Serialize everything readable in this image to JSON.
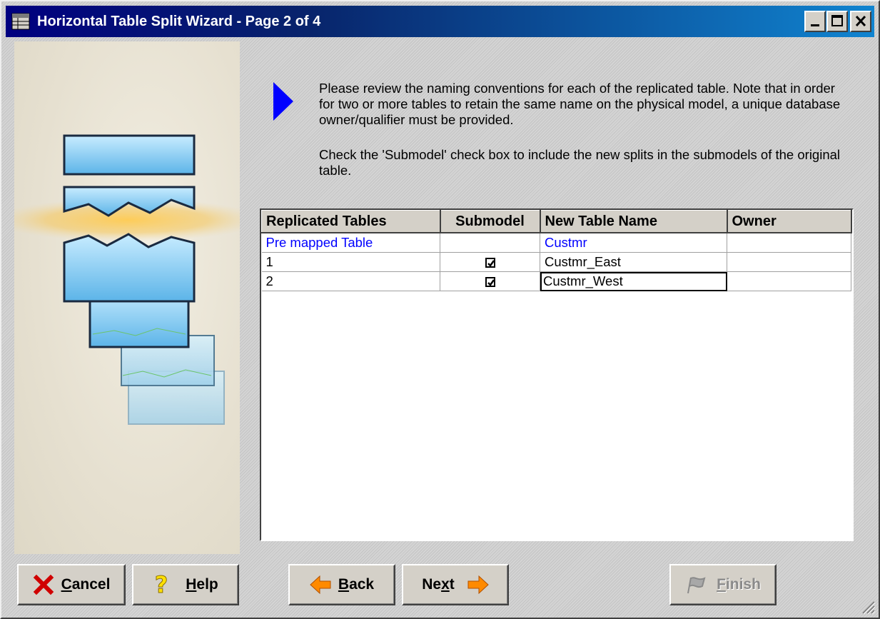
{
  "window": {
    "title": "Horizontal Table Split Wizard - Page 2 of 4"
  },
  "instructions": {
    "paragraph1": "Please review the naming conventions for each of the replicated table. Note that in order for two or more tables to retain the same name on the physical model, a unique database owner/qualifier must be provided.",
    "paragraph2": "Check the 'Submodel' check box to include the new splits in the submodels of the original table."
  },
  "grid": {
    "columns": [
      "Replicated Tables",
      "Submodel",
      "New Table Name",
      "Owner"
    ],
    "rows": [
      {
        "replicated": "Pre mapped Table",
        "submodel": "",
        "new_name": "Custmr",
        "owner": ""
      },
      {
        "replicated": "1",
        "submodel": "checked",
        "new_name": "Custmr_East",
        "owner": ""
      },
      {
        "replicated": "2",
        "submodel": "checked",
        "new_name": "Custmr_West",
        "owner": ""
      }
    ]
  },
  "buttons": {
    "cancel": {
      "accel": "C",
      "rest": "ancel"
    },
    "help": {
      "accel": "H",
      "rest": "elp"
    },
    "back": {
      "accel": "B",
      "rest": "ack"
    },
    "next": {
      "pre": "Ne",
      "accel": "x",
      "post": "t"
    },
    "finish": {
      "accel": "F",
      "rest": "inish"
    }
  },
  "colors": {
    "title_bar_start": "#000080",
    "title_bar_end": "#1084d0",
    "pre_mapped_text": "#0000ff",
    "arrow": "#0000ff",
    "nav_arrow": "#ff8a00",
    "cancel_x": "#d00000"
  },
  "icons": [
    "table-icon",
    "minimize-icon",
    "maximize-icon",
    "close-icon",
    "blue-arrow-icon",
    "cancel-x-icon",
    "question-mark-icon",
    "back-arrow-icon",
    "next-arrow-icon",
    "finish-flag-icon",
    "resize-grip-icon"
  ]
}
